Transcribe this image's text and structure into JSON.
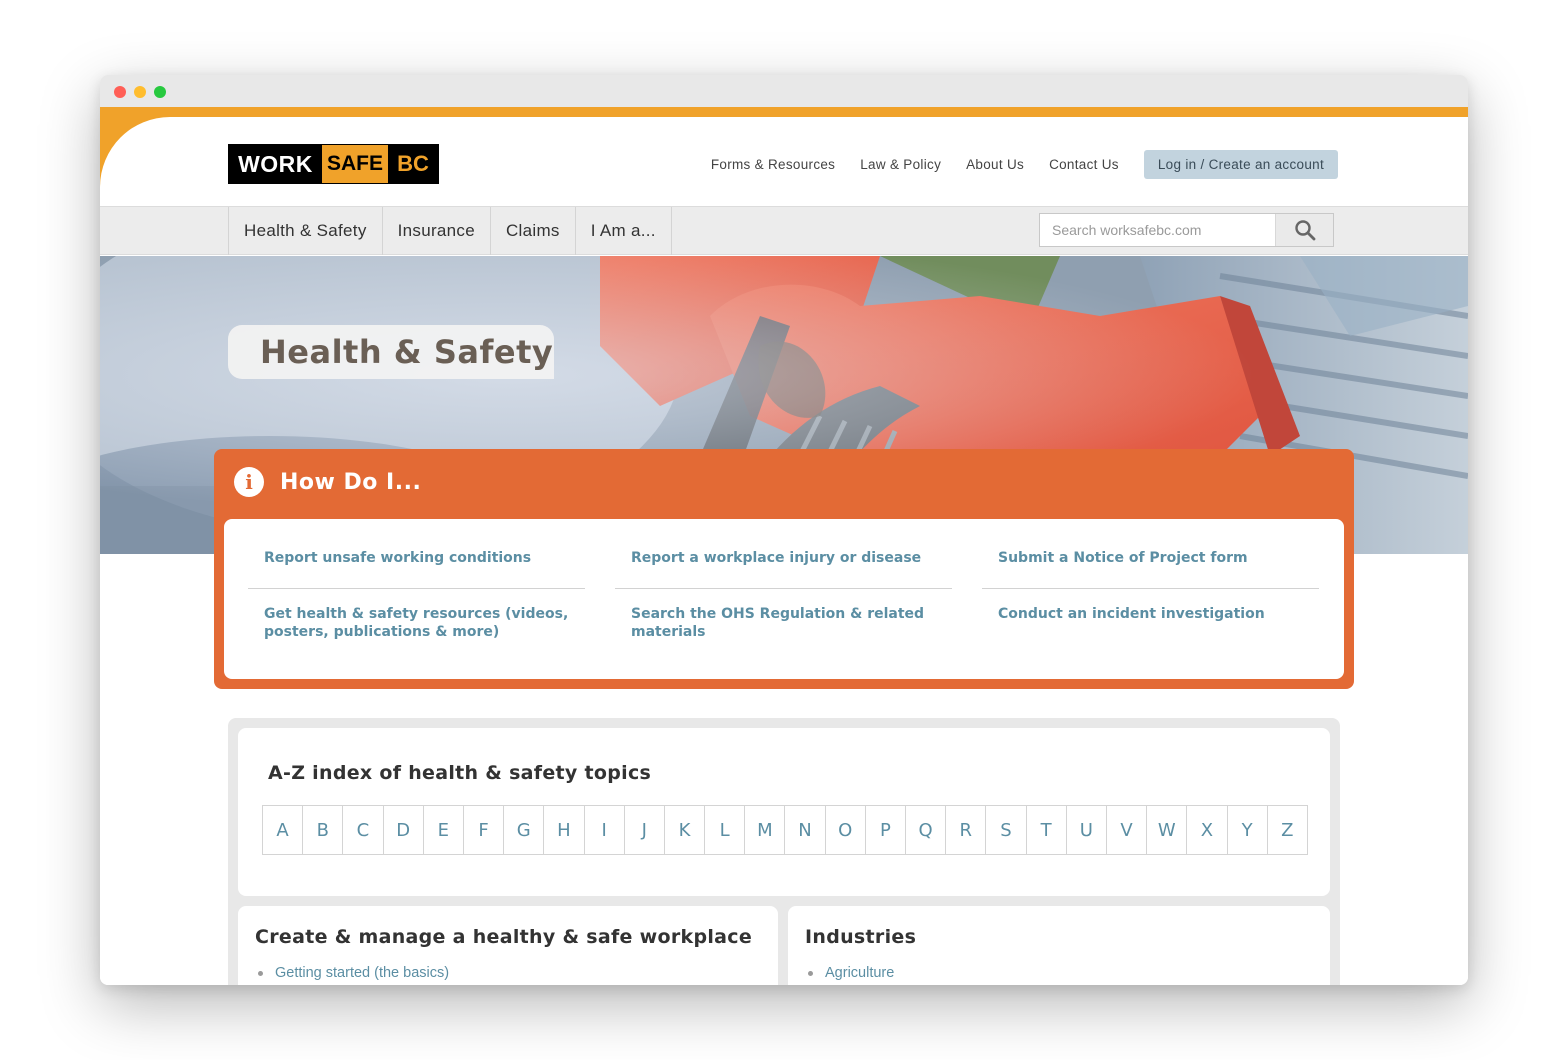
{
  "brand": {
    "logo_work": "WORK",
    "logo_safe": "SAFE",
    "logo_bc": "BC"
  },
  "utility_nav": {
    "items": [
      "Forms & Resources",
      "Law & Policy",
      "About Us",
      "Contact Us"
    ],
    "login_label": "Log in / Create an account"
  },
  "main_nav": {
    "items": [
      "Health & Safety",
      "Insurance",
      "Claims",
      "I Am a..."
    ]
  },
  "search": {
    "placeholder": "Search worksafebc.com"
  },
  "hero": {
    "title": "Health & Safety"
  },
  "how_do_i": {
    "title": "How Do I...",
    "links": [
      "Report unsafe working conditions",
      "Report a workplace injury or disease",
      "Submit a Notice of Project form",
      "Get health & safety resources (videos, posters, publications & more)",
      "Search the OHS Regulation & related materials",
      "Conduct an incident investigation"
    ]
  },
  "az_index": {
    "title": "A-Z index of health & safety topics",
    "letters": [
      "A",
      "B",
      "C",
      "D",
      "E",
      "F",
      "G",
      "H",
      "I",
      "J",
      "K",
      "L",
      "M",
      "N",
      "O",
      "P",
      "Q",
      "R",
      "S",
      "T",
      "U",
      "V",
      "W",
      "X",
      "Y",
      "Z"
    ]
  },
  "sections": {
    "left": {
      "title": "Create & manage a healthy & safe workplace",
      "first_item": "Getting started (the basics)"
    },
    "right": {
      "title": "Industries",
      "first_item": "Agriculture"
    }
  },
  "colors": {
    "brand_orange": "#f0a22a",
    "how_do_i_orange": "#e36a35",
    "link_blue": "#5b8ea3",
    "login_button_bg": "#c2d3de"
  }
}
